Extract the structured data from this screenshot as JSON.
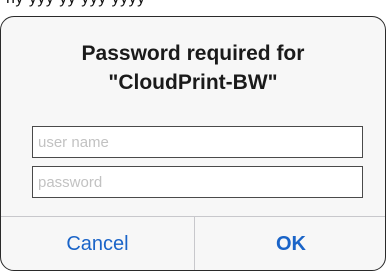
{
  "dialog": {
    "title_line1": "Password required for",
    "title_line2": "\"CloudPrint-BW\"",
    "username": {
      "value": "",
      "placeholder": "user name"
    },
    "password": {
      "value": "",
      "placeholder": "password"
    },
    "buttons": {
      "cancel_label": "Cancel",
      "ok_label": "OK"
    },
    "colors": {
      "button_text": "#1a64c8",
      "dialog_background": "#f7f7f7",
      "separator": "#c8c8cc"
    }
  }
}
